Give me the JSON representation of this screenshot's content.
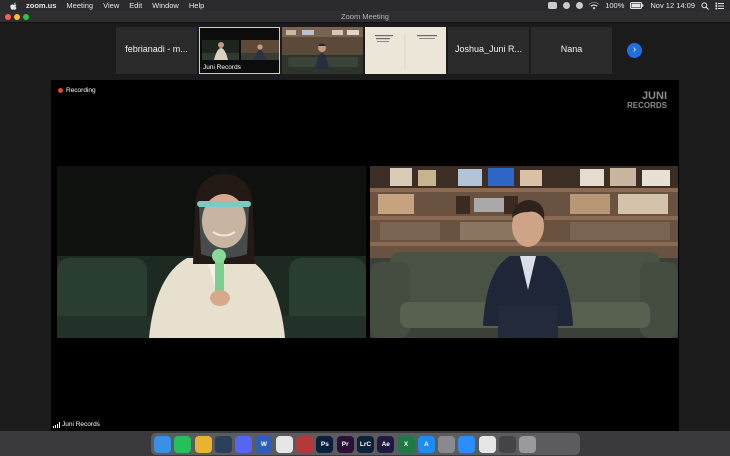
{
  "menubar": {
    "app_name": "zoom.us",
    "items": [
      "Meeting",
      "View",
      "Edit",
      "Window",
      "Help"
    ],
    "battery": "100%",
    "datetime": "Nov 12  14:09"
  },
  "window": {
    "title": "Zoom Meeting"
  },
  "gallery": {
    "tiles": [
      {
        "name": "febrianadi - m..."
      },
      {
        "caption": "Juni Records"
      },
      {
        "name": ""
      },
      {
        "name": ""
      },
      {
        "name": "Joshua_Juni R..."
      },
      {
        "name": "Nana"
      }
    ],
    "next_glyph": "›"
  },
  "stage": {
    "recording_label": "Recording",
    "watermark_line1": "JUNI",
    "watermark_line2": "RECORDS",
    "speaker_label": "Juni Records"
  },
  "dock": {
    "apps": [
      {
        "icon": "finder-icon",
        "color": "#3a8fe6",
        "text": ""
      },
      {
        "icon": "whatsapp-icon",
        "color": "#25c05a",
        "text": ""
      },
      {
        "icon": "chrome-icon",
        "color": "#e8b332",
        "text": ""
      },
      {
        "icon": "steam-icon",
        "color": "#2a3f5a",
        "text": ""
      },
      {
        "icon": "discord-icon",
        "color": "#5865f2",
        "text": ""
      },
      {
        "icon": "word-icon",
        "color": "#2b5fb8",
        "text": "W"
      },
      {
        "icon": "notes-icon",
        "color": "#e6e6e6",
        "text": ""
      },
      {
        "icon": "photo-booth-icon",
        "color": "#b23a3a",
        "text": ""
      },
      {
        "icon": "photoshop-icon",
        "color": "#0a1f3b",
        "text": "Ps"
      },
      {
        "icon": "premiere-icon",
        "color": "#2a0f3a",
        "text": "Pr"
      },
      {
        "icon": "lightroom-classic-icon",
        "color": "#0b2238",
        "text": "LrC"
      },
      {
        "icon": "after-effects-icon",
        "color": "#1e1940",
        "text": "Ae"
      },
      {
        "icon": "excel-icon",
        "color": "#1e7a44",
        "text": "X"
      },
      {
        "icon": "app-store-icon",
        "color": "#1c8cf2",
        "text": "A"
      },
      {
        "icon": "system-preferences-icon",
        "color": "#8a8a8e",
        "text": ""
      },
      {
        "icon": "zoom-icon",
        "color": "#2d8cff",
        "text": ""
      },
      {
        "icon": "itunes-icon",
        "color": "#e6e6e6",
        "text": ""
      },
      {
        "icon": "screenshot-icon",
        "color": "#444448",
        "text": ""
      },
      {
        "icon": "trash-icon",
        "color": "#9a9a9e",
        "text": ""
      }
    ]
  }
}
